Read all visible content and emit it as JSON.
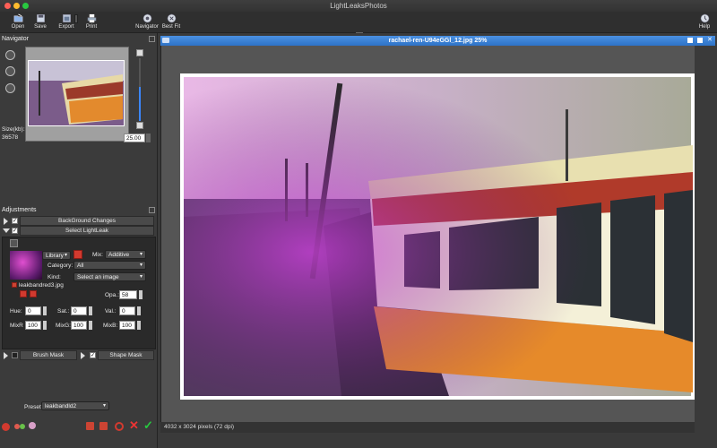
{
  "app": {
    "title": "LightLeaksPhotos"
  },
  "toolbar": {
    "open_label": "Open",
    "save_label": "Save",
    "export_label": "Export",
    "print_label": "Print",
    "navigator_label": "Navigator",
    "bestfit_label": "Best Fit",
    "help_label": "Help"
  },
  "navigator": {
    "title": "Navigator",
    "size_label": "Size(kb):",
    "size_value": "36578",
    "zoom_value": "25.00"
  },
  "adjustments": {
    "title": "Adjustments",
    "background_changes_label": "BackGround Changes",
    "select_lightleak_label": "Select LightLeak",
    "library_select": "Library",
    "mix_label": "Mix:",
    "mix_value": "Additive",
    "category_label": "Category:",
    "category_value": "All",
    "kind_label": "Kind:",
    "kind_value": "Select an image",
    "leak_filename": "leakbandred3.jpg",
    "opacity_label": "Opa.:",
    "opacity_value": "58",
    "hue_label": "Hue:",
    "hue_value": "0",
    "sat_label": "Sat.:",
    "sat_value": "0",
    "val_label": "Val.:",
    "val_value": "0",
    "mixr_label": "MixR",
    "mixr_value": "100",
    "mixg_label": "MixG:",
    "mixg_value": "100",
    "mixb_label": "MixB:",
    "mixb_value": "100",
    "brush_mask_label": "Brush Mask",
    "shape_mask_label": "Shape Mask"
  },
  "preset": {
    "label": "Preset:",
    "value": "leakbandld2"
  },
  "document": {
    "title": "rachael-ren-U94eGGl_12.jpg 25%",
    "status": "4032 x 3024 pixels (72 dpi)"
  },
  "colors": {
    "accent": "#2e73c7",
    "red_button": "#d23a2f",
    "green_check": "#27c93f"
  }
}
